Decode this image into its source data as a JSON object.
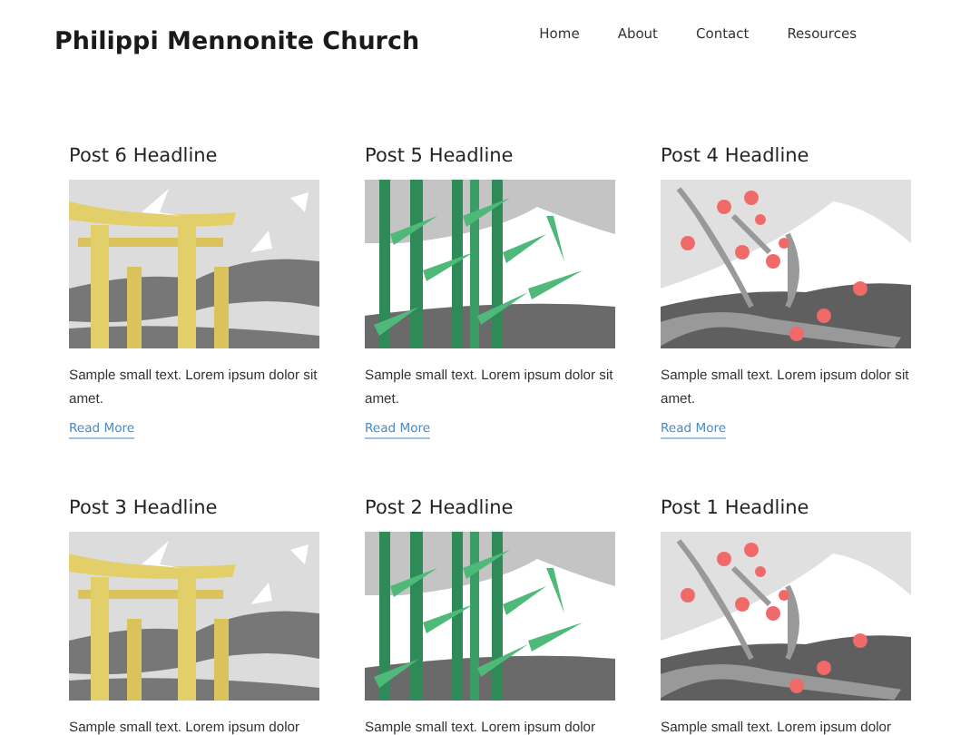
{
  "site_title": "Philippi Mennonite Church",
  "nav": [
    {
      "label": "Home"
    },
    {
      "label": "About"
    },
    {
      "label": "Contact"
    },
    {
      "label": "Resources"
    }
  ],
  "posts": [
    {
      "headline": "Post 6 Headline",
      "image": {
        "kind": "torii"
      },
      "excerpt": "Sample small text. Lorem ipsum dolor sit amet.",
      "link": "Read More"
    },
    {
      "headline": "Post 5 Headline",
      "image": {
        "kind": "bamboo"
      },
      "excerpt": "Sample small text. Lorem ipsum dolor sit amet.",
      "link": "Read More"
    },
    {
      "headline": "Post 4 Headline",
      "image": {
        "kind": "blossom"
      },
      "excerpt": "Sample small text. Lorem ipsum dolor sit amet.",
      "link": "Read More"
    },
    {
      "headline": "Post 3 Headline",
      "image": {
        "kind": "torii"
      },
      "excerpt": "Sample small text. Lorem ipsum dolor"
    },
    {
      "headline": "Post 2 Headline",
      "image": {
        "kind": "bamboo"
      },
      "excerpt": "Sample small text. Lorem ipsum dolor"
    },
    {
      "headline": "Post 1 Headline",
      "image": {
        "kind": "blossom"
      },
      "excerpt": "Sample small text. Lorem ipsum dolor"
    }
  ]
}
